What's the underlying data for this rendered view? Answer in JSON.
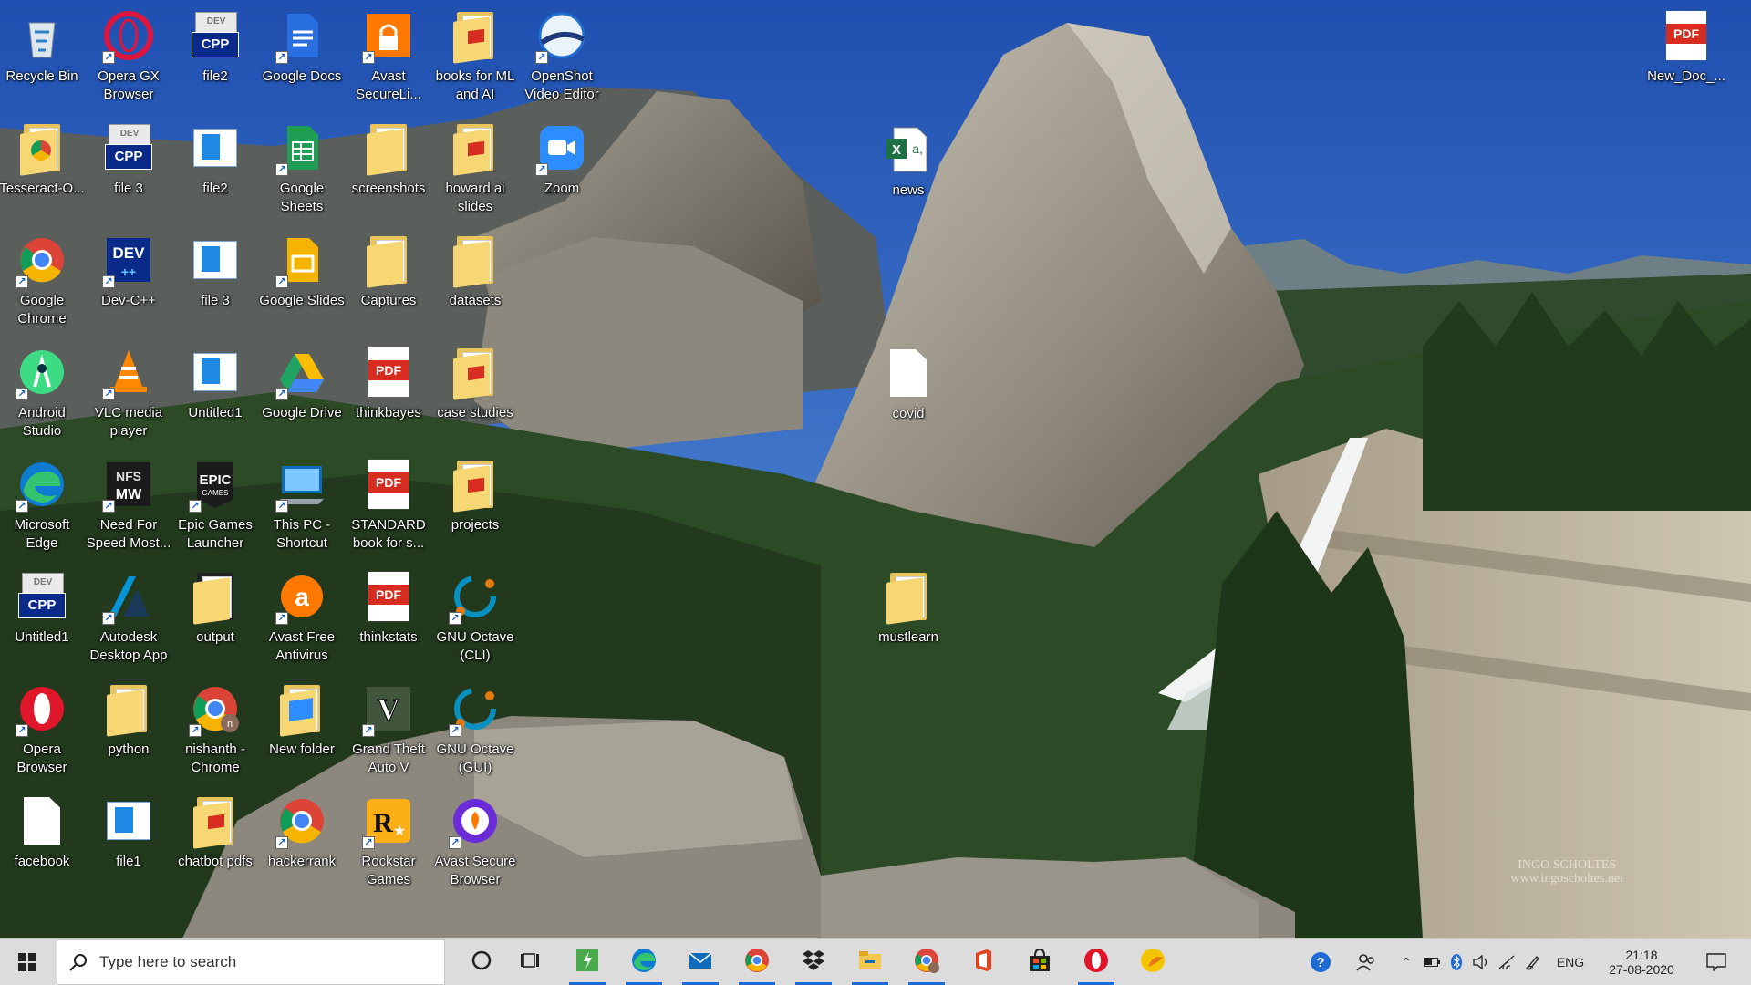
{
  "desktop_icons": [
    {
      "label": "Recycle Bin",
      "icon": "recycle-bin-icon",
      "col": 0,
      "row": 0
    },
    {
      "label": "Opera GX Browser",
      "icon": "opera-gx-icon",
      "col": 1,
      "row": 0
    },
    {
      "label": "file2",
      "icon": "cpp-file-icon",
      "col": 2,
      "row": 0
    },
    {
      "label": "Google Docs",
      "icon": "google-docs-icon",
      "col": 3,
      "row": 0
    },
    {
      "label": "Avast SecureLi...",
      "icon": "avast-secureline-icon",
      "col": 4,
      "row": 0
    },
    {
      "label": "books for ML and AI",
      "icon": "folder-pdf-icon",
      "col": 5,
      "row": 0
    },
    {
      "label": "OpenShot Video Editor",
      "icon": "openshot-icon",
      "col": 6,
      "row": 0
    },
    {
      "label": "Tesseract-O...",
      "icon": "folder-chrome-icon",
      "col": 0,
      "row": 1
    },
    {
      "label": "file 3",
      "icon": "cpp-file-icon",
      "col": 1,
      "row": 1
    },
    {
      "label": "file2",
      "icon": "windows-file-icon",
      "col": 2,
      "row": 1
    },
    {
      "label": "Google Sheets",
      "icon": "google-sheets-icon",
      "col": 3,
      "row": 1
    },
    {
      "label": "screenshots",
      "icon": "folder-icon",
      "col": 4,
      "row": 1
    },
    {
      "label": "howard ai slides",
      "icon": "folder-pdf-icon",
      "col": 5,
      "row": 1
    },
    {
      "label": "Zoom",
      "icon": "zoom-icon",
      "col": 6,
      "row": 1
    },
    {
      "label": "Google Chrome",
      "icon": "chrome-icon",
      "col": 0,
      "row": 2
    },
    {
      "label": "Dev-C++",
      "icon": "devcpp-icon",
      "col": 1,
      "row": 2
    },
    {
      "label": "file 3",
      "icon": "windows-file-icon",
      "col": 2,
      "row": 2
    },
    {
      "label": "Google Slides",
      "icon": "google-slides-icon",
      "col": 3,
      "row": 2
    },
    {
      "label": "Captures",
      "icon": "folder-icon",
      "col": 4,
      "row": 2
    },
    {
      "label": "datasets",
      "icon": "folder-icon",
      "col": 5,
      "row": 2
    },
    {
      "label": "Android Studio",
      "icon": "android-studio-icon",
      "col": 0,
      "row": 3
    },
    {
      "label": "VLC media player",
      "icon": "vlc-icon",
      "col": 1,
      "row": 3
    },
    {
      "label": "Untitled1",
      "icon": "windows-file-icon",
      "col": 2,
      "row": 3
    },
    {
      "label": "Google Drive",
      "icon": "google-drive-icon",
      "col": 3,
      "row": 3
    },
    {
      "label": "thinkbayes",
      "icon": "pdf-icon",
      "col": 4,
      "row": 3
    },
    {
      "label": "case studies",
      "icon": "folder-pdf-icon",
      "col": 5,
      "row": 3
    },
    {
      "label": "Microsoft Edge",
      "icon": "edge-icon",
      "col": 0,
      "row": 4
    },
    {
      "label": "Need For Speed Most...",
      "icon": "nfs-icon",
      "col": 1,
      "row": 4
    },
    {
      "label": "Epic Games Launcher",
      "icon": "epic-games-icon",
      "col": 2,
      "row": 4
    },
    {
      "label": "This PC - Shortcut",
      "icon": "this-pc-icon",
      "col": 3,
      "row": 4
    },
    {
      "label": "STANDARD book for s...",
      "icon": "pdf-icon",
      "col": 4,
      "row": 4
    },
    {
      "label": "projects",
      "icon": "folder-pdf-icon",
      "col": 5,
      "row": 4
    },
    {
      "label": "Untitled1",
      "icon": "cpp-file-icon",
      "col": 0,
      "row": 5
    },
    {
      "label": "Autodesk Desktop App",
      "icon": "autodesk-icon",
      "col": 1,
      "row": 5
    },
    {
      "label": "output",
      "icon": "folder-dark-icon",
      "col": 2,
      "row": 5
    },
    {
      "label": "Avast Free Antivirus",
      "icon": "avast-icon",
      "col": 3,
      "row": 5
    },
    {
      "label": "thinkstats",
      "icon": "pdf-icon",
      "col": 4,
      "row": 5
    },
    {
      "label": "GNU Octave (CLI)",
      "icon": "octave-icon",
      "col": 5,
      "row": 5
    },
    {
      "label": "Opera Browser",
      "icon": "opera-icon",
      "col": 0,
      "row": 6
    },
    {
      "label": "python",
      "icon": "folder-icon",
      "col": 1,
      "row": 6
    },
    {
      "label": "nishanth - Chrome",
      "icon": "chrome-profile-icon",
      "col": 2,
      "row": 6
    },
    {
      "label": "New folder",
      "icon": "folder-image-icon",
      "col": 3,
      "row": 6
    },
    {
      "label": "Grand Theft Auto V",
      "icon": "gta-icon",
      "col": 4,
      "row": 6
    },
    {
      "label": "GNU Octave (GUI)",
      "icon": "octave-icon",
      "col": 5,
      "row": 6
    },
    {
      "label": "facebook",
      "icon": "blank-file-icon",
      "col": 0,
      "row": 7
    },
    {
      "label": "file1",
      "icon": "windows-file-icon",
      "col": 1,
      "row": 7
    },
    {
      "label": "chatbot pdfs",
      "icon": "folder-pdf-icon",
      "col": 2,
      "row": 7
    },
    {
      "label": "hackerrank",
      "icon": "chrome-icon",
      "col": 3,
      "row": 7
    },
    {
      "label": "Rockstar Games",
      "icon": "rockstar-icon",
      "col": 4,
      "row": 7
    },
    {
      "label": "Avast Secure Browser",
      "icon": "avast-browser-icon",
      "col": 5,
      "row": 7
    }
  ],
  "loose_icons": [
    {
      "label": "news",
      "icon": "excel-icon",
      "id": "news"
    },
    {
      "label": "covid",
      "icon": "blank-file-icon",
      "id": "covid"
    },
    {
      "label": "mustlearn",
      "icon": "folder-icon",
      "id": "mustlearn"
    },
    {
      "label": "New_Doc_...",
      "icon": "pdf-icon",
      "id": "newdoc"
    }
  ],
  "wallpaper_credit": {
    "name": "INGO SCHOLTES",
    "url": "www.ingoscholtes.net"
  },
  "taskbar": {
    "search_placeholder": "Type here to search",
    "pinned": [
      {
        "name": "cortana-icon"
      },
      {
        "name": "task-view-icon"
      },
      {
        "name": "green-app-icon"
      },
      {
        "name": "edge-icon"
      },
      {
        "name": "mail-icon"
      },
      {
        "name": "chrome-icon"
      },
      {
        "name": "dropbox-icon"
      },
      {
        "name": "file-explorer-icon"
      },
      {
        "name": "chrome-profile-icon"
      },
      {
        "name": "office-icon"
      },
      {
        "name": "store-icon"
      },
      {
        "name": "opera-icon"
      },
      {
        "name": "yellow-app-icon"
      }
    ],
    "tray": {
      "language": "ENG",
      "time": "21:18",
      "date": "27-08-2020"
    }
  },
  "colors": {
    "taskbar_bg": "#dcdcdc",
    "sky": "#2f5fb8",
    "accent": "#1e6bd6"
  }
}
